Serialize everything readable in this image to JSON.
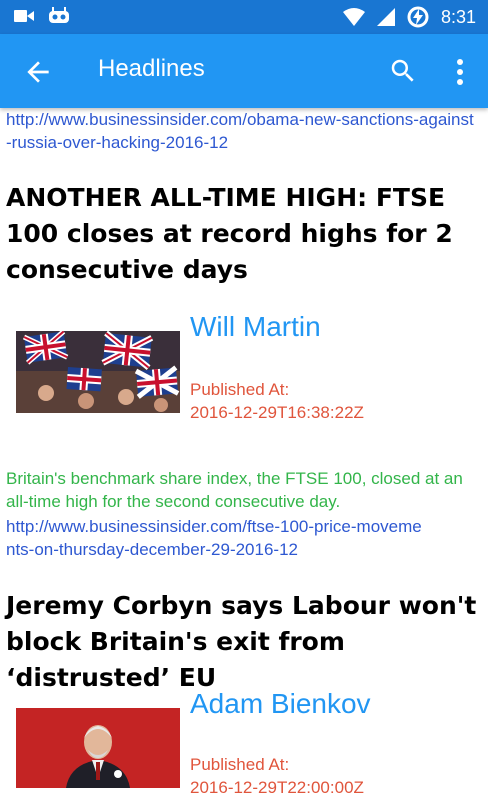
{
  "status_bar": {
    "time": "8:31",
    "icons": [
      "video-camera-icon",
      "android-icon",
      "wifi-icon",
      "signal-icon",
      "battery-charging-icon"
    ]
  },
  "toolbar": {
    "title": "Headlines",
    "back_icon": "arrow-back-icon",
    "search_icon": "search-icon",
    "more_icon": "more-vert-icon"
  },
  "articles": [
    {
      "url": "http://www.businessinsider.com/obama-new-sanctions-against-russia-over-hacking-2016-12"
    },
    {
      "headline": "ANOTHER ALL-TIME HIGH: FTSE 100 closes at record highs for 2 consecutive days",
      "author": "Will Martin",
      "published_label": "Published At:",
      "published_at": "2016-12-29T16:38:22Z",
      "description": "Britain's benchmark share index, the FTSE 100, closed at an all-time high for the second consecutive day.",
      "url": "http://www.businessinsider.com/ftse-100-price-movements-on-thursday-december-29-2016-12"
    },
    {
      "headline": "Jeremy Corbyn says Labour won't block Britain's exit from ‘distrusted’ EU",
      "author": "Adam Bienkov",
      "published_label": "Published At:",
      "published_at": "2016-12-29T22:00:00Z"
    }
  ],
  "colors": {
    "status_bar": "#1976D2",
    "toolbar": "#2196F3",
    "author": "#2196F3",
    "published": "#e0553c",
    "description": "#33b54a",
    "link": "#2e58d1"
  }
}
